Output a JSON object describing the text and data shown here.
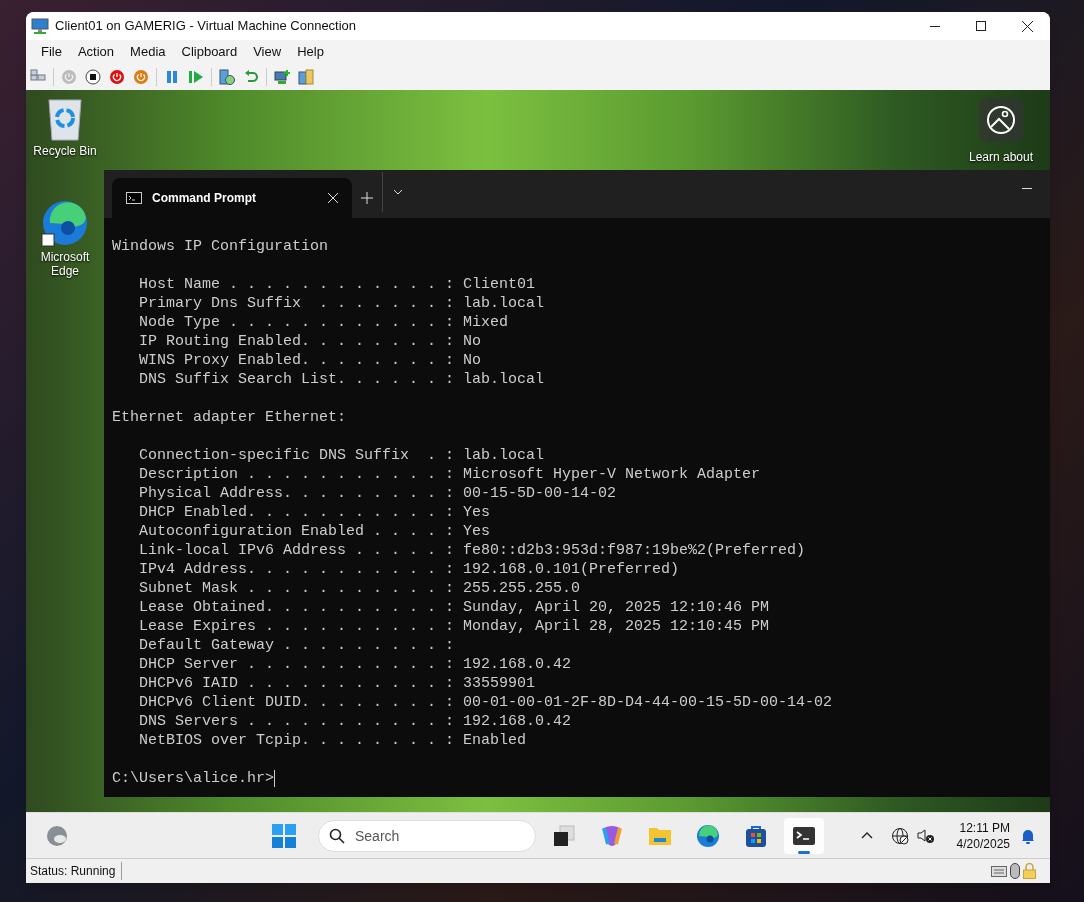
{
  "window": {
    "title": "Client01 on GAMERIG - Virtual Machine Connection"
  },
  "menu": [
    "File",
    "Action",
    "Media",
    "Clipboard",
    "View",
    "Help"
  ],
  "toolbar": [
    {
      "kind": "keys"
    },
    {
      "kind": "start"
    },
    {
      "kind": "turn-off"
    },
    {
      "kind": "shut-down"
    },
    {
      "kind": "save"
    },
    {
      "kind": "pause"
    },
    {
      "kind": "reset"
    },
    {
      "kind": "checkpoint"
    },
    {
      "kind": "revert"
    },
    {
      "kind": "enhanced"
    },
    {
      "kind": "share"
    }
  ],
  "desktop": {
    "icons": [
      {
        "kind": "recycle",
        "label": "Recycle Bin"
      },
      {
        "kind": "edge",
        "label": "Microsoft Edge"
      }
    ],
    "spotlight": {
      "label": "Learn about"
    }
  },
  "terminal": {
    "tabs": [
      {
        "title": "Command Prompt",
        "selected": true
      }
    ],
    "output": [
      [
        "Windows IP Configuration"
      ],
      [
        "   Host Name . . . . . . . . . . . . : Client01",
        "   Primary Dns Suffix  . . . . . . . : lab.local",
        "   Node Type . . . . . . . . . . . . : Mixed",
        "   IP Routing Enabled. . . . . . . . : No",
        "   WINS Proxy Enabled. . . . . . . . : No",
        "   DNS Suffix Search List. . . . . . : lab.local"
      ],
      [
        "Ethernet adapter Ethernet:"
      ],
      [
        "   Connection-specific DNS Suffix  . : lab.local",
        "   Description . . . . . . . . . . . : Microsoft Hyper-V Network Adapter",
        "   Physical Address. . . . . . . . . : 00-15-5D-00-14-02",
        "   DHCP Enabled. . . . . . . . . . . : Yes",
        "   Autoconfiguration Enabled . . . . : Yes",
        "   Link-local IPv6 Address . . . . . : fe80::d2b3:953d:f987:19be%2(Preferred)",
        "   IPv4 Address. . . . . . . . . . . : 192.168.0.101(Preferred)",
        "   Subnet Mask . . . . . . . . . . . : 255.255.255.0",
        "   Lease Obtained. . . . . . . . . . : Sunday, April 20, 2025 12:10:46 PM",
        "   Lease Expires . . . . . . . . . . : Monday, April 28, 2025 12:10:45 PM",
        "   Default Gateway . . . . . . . . . :",
        "   DHCP Server . . . . . . . . . . . : 192.168.0.42",
        "   DHCPv6 IAID . . . . . . . . . . . : 33559901",
        "   DHCPv6 Client DUID. . . . . . . . : 00-01-00-01-2F-8D-D4-44-00-15-5D-00-14-02",
        "   DNS Servers . . . . . . . . . . . : 192.168.0.42",
        "   NetBIOS over Tcpip. . . . . . . . : Enabled"
      ]
    ],
    "prompt": "C:\\Users\\alice.hr>"
  },
  "taskbar": {
    "search": {
      "placeholder": "Search"
    },
    "apps": [
      {
        "kind": "task-view",
        "selected": false
      },
      {
        "kind": "copilot",
        "selected": false
      },
      {
        "kind": "explorer",
        "selected": false
      },
      {
        "kind": "edge",
        "selected": false
      },
      {
        "kind": "store",
        "selected": false
      },
      {
        "kind": "terminal",
        "selected": true
      }
    ],
    "time": "12:11 PM",
    "date": "4/20/2025"
  },
  "status_bar": {
    "text": "Status: Running"
  }
}
